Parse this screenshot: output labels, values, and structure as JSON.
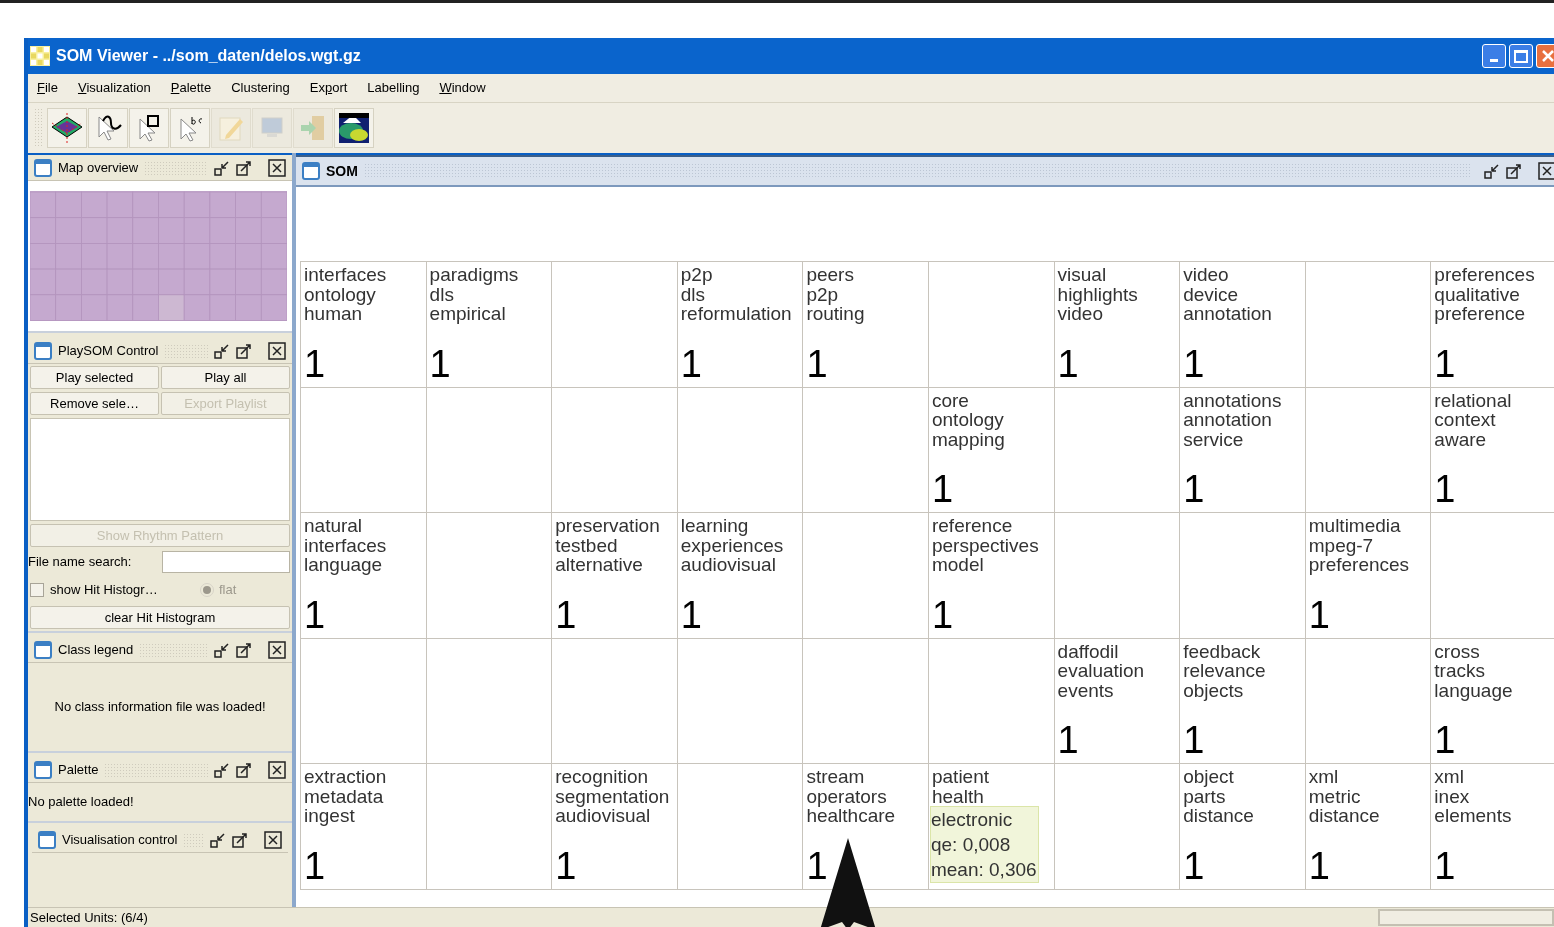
{
  "window": {
    "title": "SOM Viewer - ../som_daten/delos.wgt.gz"
  },
  "menu": [
    {
      "parts": [
        {
          "text": "F",
          "underline": true
        },
        {
          "text": "ile",
          "underline": false
        }
      ]
    },
    {
      "parts": [
        {
          "text": "V",
          "underline": true
        },
        {
          "text": "isualization",
          "underline": false
        }
      ]
    },
    {
      "parts": [
        {
          "text": "P",
          "underline": true
        },
        {
          "text": "alette",
          "underline": false
        }
      ]
    },
    {
      "parts": [
        {
          "text": "Clustering",
          "underline": false
        }
      ]
    },
    {
      "parts": [
        {
          "text": "Ex",
          "underline": false
        },
        {
          "text": "p",
          "underline": true
        },
        {
          "text": "ort",
          "underline": false
        }
      ]
    },
    {
      "parts": [
        {
          "text": "Labelling",
          "underline": false
        }
      ]
    },
    {
      "parts": [
        {
          "text": "W",
          "underline": true
        },
        {
          "text": "indow",
          "underline": false
        }
      ]
    }
  ],
  "toolbar": [
    {
      "kind": "grid3d",
      "disabled": false
    },
    {
      "kind": "path",
      "disabled": false
    },
    {
      "kind": "rect",
      "disabled": false
    },
    {
      "kind": "label",
      "disabled": false
    },
    {
      "kind": "edit",
      "disabled": true
    },
    {
      "kind": "monitor",
      "disabled": true
    },
    {
      "kind": "exit",
      "disabled": true
    },
    {
      "kind": "terrain",
      "disabled": false
    }
  ],
  "map_overview": {
    "title": "Map overview"
  },
  "playsom": {
    "title": "PlaySOM Control",
    "buttons": [
      {
        "label": "Play selected",
        "disabled": false
      },
      {
        "label": "Play all",
        "disabled": false
      },
      {
        "label": "Remove sele…",
        "disabled": false
      },
      {
        "label": "Export Playlist",
        "disabled": true
      }
    ],
    "rhythm_button": {
      "label": "Show Rhythm Pattern",
      "disabled": true
    },
    "search": {
      "label": "File name search:"
    },
    "hit_histogram": {
      "label": "show Hit Histogr…",
      "checked": false
    },
    "flat": {
      "label": "flat",
      "selected": true,
      "disabled": true
    },
    "clear_button": {
      "label": "clear Hit Histogram"
    }
  },
  "class_legend": {
    "title": "Class legend",
    "message": "No class information file was loaded!"
  },
  "palette": {
    "title": "Palette",
    "message": "No palette loaded!"
  },
  "visualisation_control": {
    "title": "Visualisation control"
  },
  "som": {
    "title": "SOM",
    "rows": [
      [
        {
          "labels": [
            "interfaces",
            "ontology",
            "human"
          ],
          "count": "1"
        },
        {
          "labels": [
            "paradigms",
            "dls",
            "empirical"
          ],
          "count": "1"
        },
        {},
        {
          "labels": [
            "p2p",
            "dls",
            "reformulation"
          ],
          "count": "1"
        },
        {
          "labels": [
            "peers",
            "p2p",
            "routing"
          ],
          "count": "1"
        },
        {},
        {
          "labels": [
            "visual",
            "highlights",
            "video"
          ],
          "count": "1"
        },
        {
          "labels": [
            "video",
            "device",
            "annotation"
          ],
          "count": "1"
        },
        {},
        {
          "labels": [
            "preferences",
            "qualitative",
            "preference"
          ],
          "count": "1"
        }
      ],
      [
        {},
        {},
        {},
        {},
        {},
        {
          "labels": [
            "core",
            "ontology",
            "mapping"
          ],
          "count": "1"
        },
        {},
        {
          "labels": [
            "annotations",
            "annotation",
            "service"
          ],
          "count": "1"
        },
        {},
        {
          "labels": [
            "relational",
            "context",
            "aware"
          ],
          "count": "1"
        }
      ],
      [
        {
          "labels": [
            "natural",
            "interfaces",
            "language"
          ],
          "count": "1"
        },
        {},
        {
          "labels": [
            "preservation",
            "testbed",
            "alternative"
          ],
          "count": "1"
        },
        {
          "labels": [
            "learning",
            "experiences",
            "audiovisual"
          ],
          "count": "1"
        },
        {},
        {
          "labels": [
            "reference",
            "perspectives",
            "model"
          ],
          "count": "1"
        },
        {},
        {},
        {
          "labels": [
            "multimedia",
            "mpeg-7",
            "preferences"
          ],
          "count": "1"
        },
        {}
      ],
      [
        {},
        {},
        {},
        {},
        {},
        {},
        {
          "labels": [
            "daffodil",
            "evaluation",
            "events"
          ],
          "count": "1"
        },
        {
          "labels": [
            "feedback",
            "relevance",
            "objects"
          ],
          "count": "1"
        },
        {},
        {
          "labels": [
            "cross",
            "tracks",
            "language"
          ],
          "count": "1"
        }
      ],
      [
        {
          "labels": [
            "extraction",
            "metadata",
            "ingest"
          ],
          "count": "1"
        },
        {},
        {
          "labels": [
            "recognition",
            "segmentation",
            "audiovisual"
          ],
          "count": "1"
        },
        {},
        {
          "labels": [
            "stream",
            "operators",
            "healthcare"
          ],
          "count": "1"
        },
        {
          "labels": [
            "patient",
            "health"
          ],
          "tooltip": [
            "electronic",
            "qe: 0,008",
            "mean: 0,306"
          ]
        },
        {},
        {
          "labels": [
            "object",
            "parts",
            "distance"
          ],
          "count": "1"
        },
        {
          "labels": [
            "xml",
            "metric",
            "distance"
          ],
          "count": "1"
        },
        {
          "labels": [
            "xml",
            "inex",
            "elements"
          ],
          "count": "1"
        }
      ]
    ]
  },
  "status_bar": {
    "text": "Selected Units: (6/4)"
  }
}
